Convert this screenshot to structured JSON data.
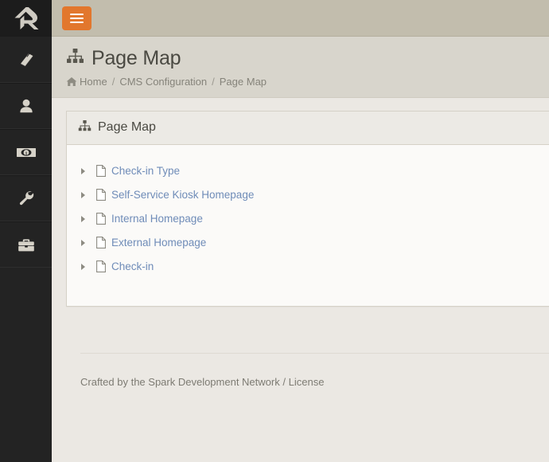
{
  "brand": {
    "logo_name": "rock-logo",
    "accent_color": "#e2772d",
    "sidebar_color": "#232323",
    "topbar_color": "#c2bdad",
    "link_color": "#6f8cb8"
  },
  "topbar": {
    "menu_toggle_label": "Toggle navigation",
    "menu_icon": "hamburger-icon"
  },
  "sidebar": {
    "items": [
      {
        "icon": "book-icon",
        "label": "CMS"
      },
      {
        "icon": "person-icon",
        "label": "People"
      },
      {
        "icon": "money-bill-icon",
        "label": "Finance"
      },
      {
        "icon": "wrench-icon",
        "label": "Admin Tools"
      },
      {
        "icon": "briefcase-icon",
        "label": "Tools"
      }
    ]
  },
  "page": {
    "title": "Page Map",
    "title_icon": "sitemap-icon",
    "breadcrumb": [
      {
        "label": "Home",
        "icon": "home-icon"
      },
      {
        "label": "CMS Configuration",
        "icon": ""
      },
      {
        "label": "Page Map",
        "icon": ""
      }
    ],
    "breadcrumb_separator": "/"
  },
  "panel": {
    "title": "Page Map",
    "title_icon": "sitemap-icon",
    "tree": [
      {
        "label": "Check-in Type",
        "icon": "file-icon",
        "toggle": "caret-right-icon"
      },
      {
        "label": "Self-Service Kiosk Homepage",
        "icon": "file-icon",
        "toggle": "caret-right-icon"
      },
      {
        "label": "Internal Homepage",
        "icon": "file-icon",
        "toggle": "caret-right-icon"
      },
      {
        "label": "External Homepage",
        "icon": "file-icon",
        "toggle": "caret-right-icon"
      },
      {
        "label": "Check-in",
        "icon": "file-icon",
        "toggle": "caret-right-icon"
      }
    ]
  },
  "footer": {
    "credit_text": "Crafted by the Spark Development Network",
    "separator": "/",
    "license_label": "License"
  }
}
